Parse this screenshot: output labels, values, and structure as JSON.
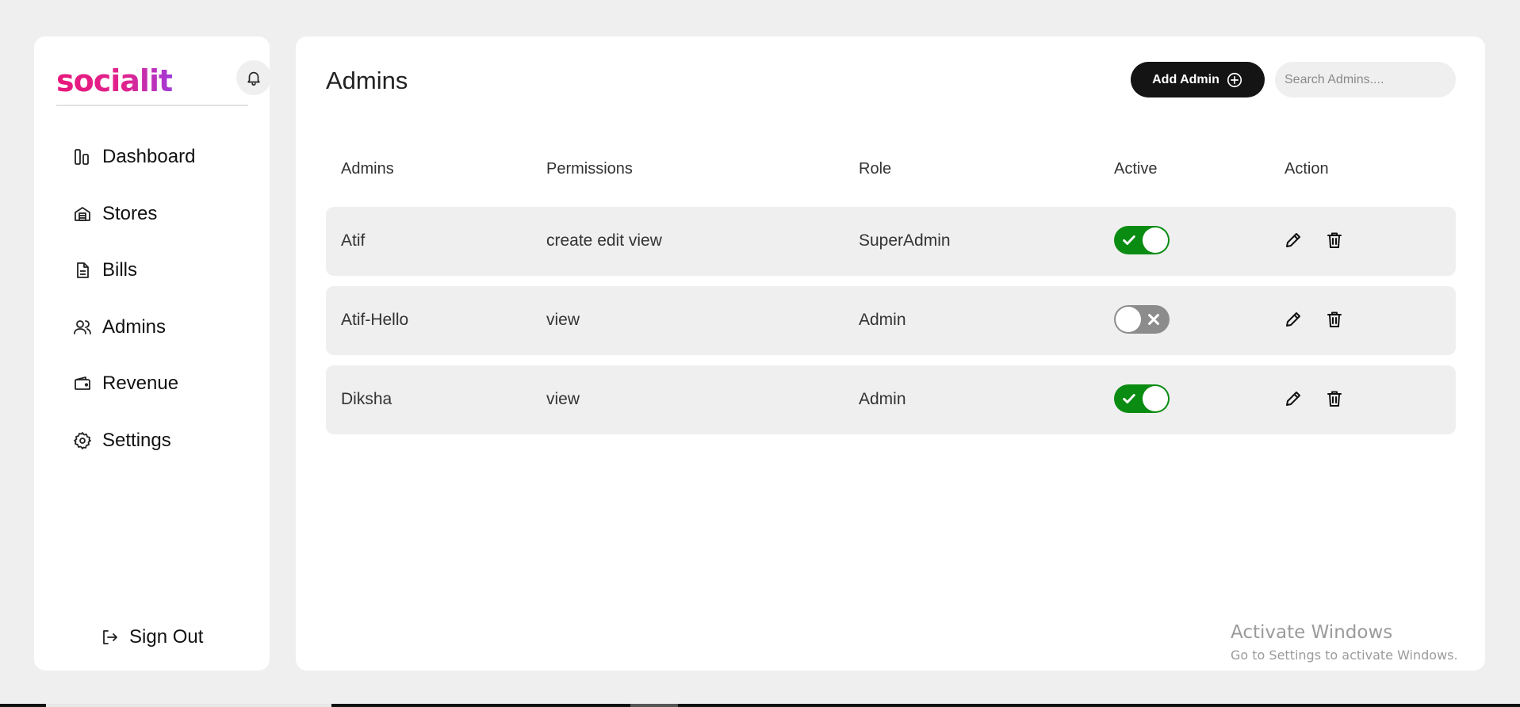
{
  "app": {
    "logo_text": "socialit",
    "brand_colors": {
      "pink": "#e8177b",
      "purple": "#a23ad8"
    }
  },
  "sidebar": {
    "items": [
      {
        "label": "Dashboard",
        "icon": "dashboard-icon"
      },
      {
        "label": "Stores",
        "icon": "store-icon"
      },
      {
        "label": "Bills",
        "icon": "document-icon"
      },
      {
        "label": "Admins",
        "icon": "users-icon"
      },
      {
        "label": "Revenue",
        "icon": "wallet-icon"
      },
      {
        "label": "Settings",
        "icon": "gear-icon"
      }
    ],
    "sign_out_label": "Sign Out"
  },
  "header": {
    "title": "Admins",
    "add_button_label": "Add Admin",
    "search_placeholder": "Search Admins...."
  },
  "table": {
    "columns": [
      "Admins",
      "Permissions",
      "Role",
      "Active",
      "Action"
    ],
    "rows": [
      {
        "name": "Atif",
        "permissions": "create edit view",
        "role": "SuperAdmin",
        "active": true
      },
      {
        "name": "Atif-Hello",
        "permissions": "view",
        "role": "Admin",
        "active": false
      },
      {
        "name": "Diksha",
        "permissions": "view",
        "role": "Admin",
        "active": true
      }
    ]
  },
  "colors": {
    "active_on": "#0a8c12",
    "active_off": "#8c8c8c"
  },
  "watermark": {
    "title": "Activate Windows",
    "subtitle": "Go to Settings to activate Windows."
  }
}
